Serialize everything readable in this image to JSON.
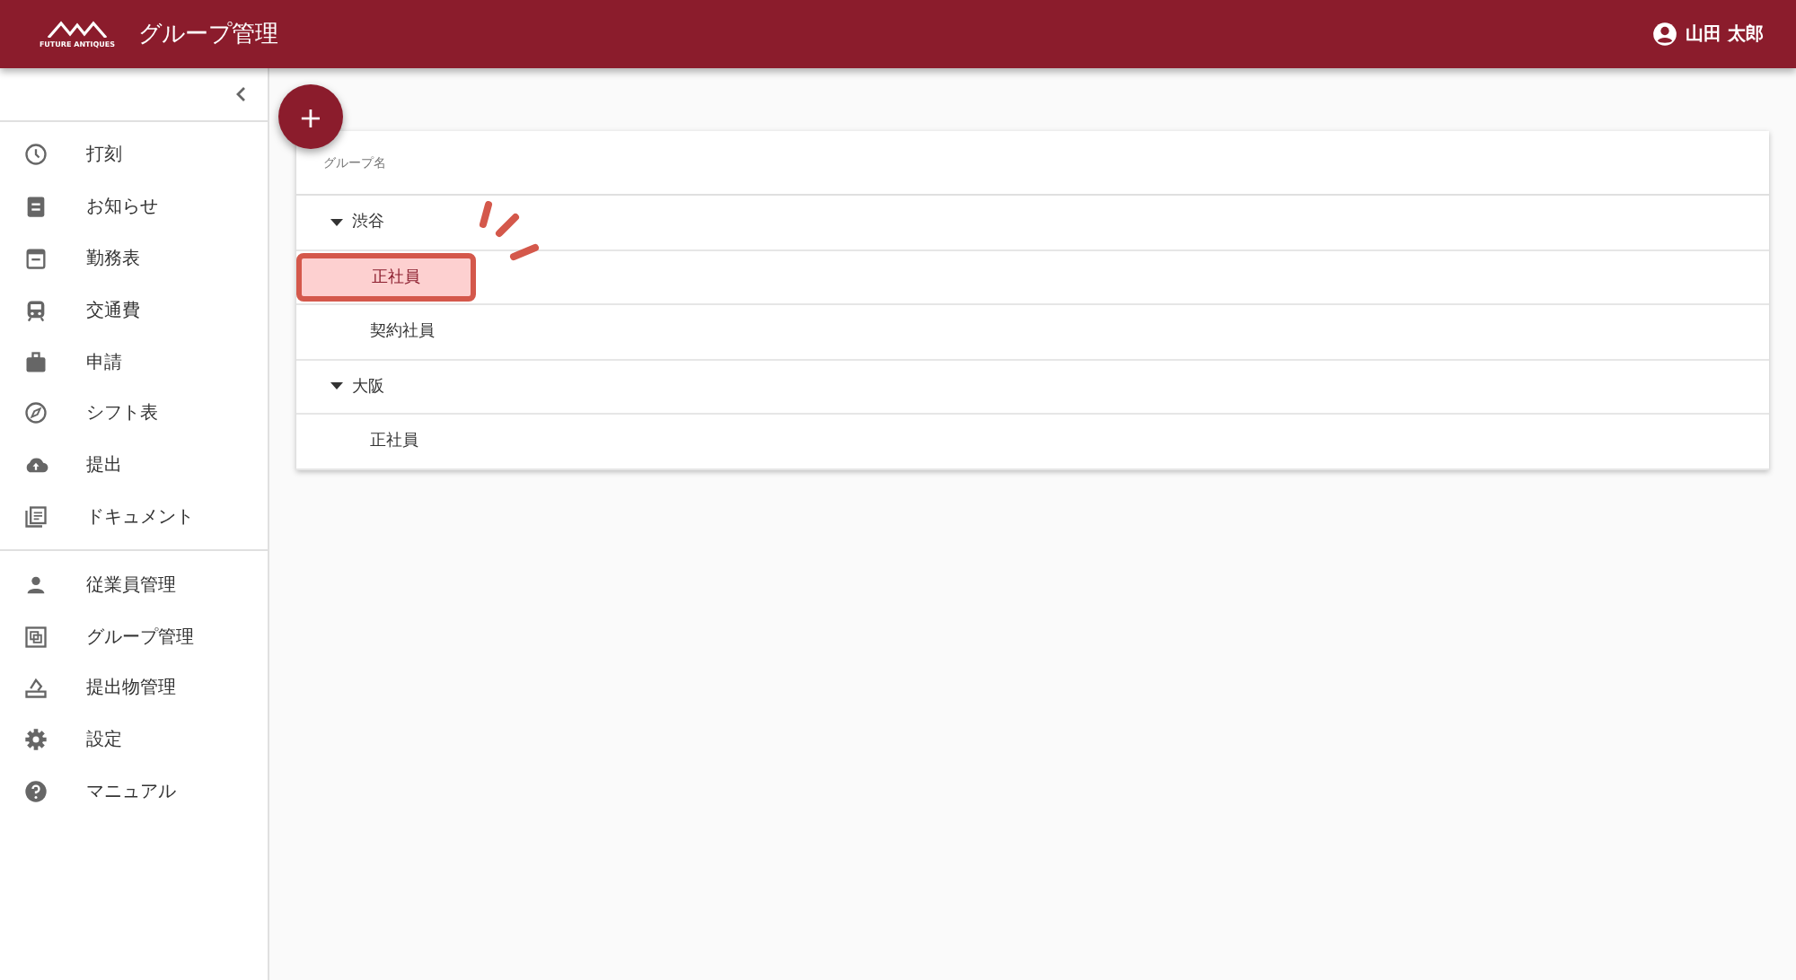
{
  "header": {
    "logo_text": "FUTURE ANTIQUES",
    "title": "グループ管理",
    "user": "山田 太郎"
  },
  "sidebar": {
    "sections": [
      {
        "items": [
          {
            "label": "打刻",
            "selected": false
          },
          {
            "label": "お知らせ",
            "selected": false
          },
          {
            "label": "勤務表",
            "selected": false
          },
          {
            "label": "交通費",
            "selected": false
          },
          {
            "label": "申請",
            "selected": false
          },
          {
            "label": "シフト表",
            "selected": false
          },
          {
            "label": "提出",
            "selected": false
          },
          {
            "label": "ドキュメント",
            "selected": false
          }
        ]
      },
      {
        "items": [
          {
            "label": "従業員管理",
            "selected": false
          },
          {
            "label": "グループ管理",
            "selected": false
          },
          {
            "label": "提出物管理",
            "selected": false
          },
          {
            "label": "設定",
            "selected": false
          },
          {
            "label": "マニュアル",
            "selected": false
          }
        ]
      }
    ]
  },
  "add_button": {
    "label": "+"
  },
  "tree": {
    "column": "グループ名",
    "groups": [
      {
        "label": "渋谷",
        "expanded": true,
        "children": [
          {
            "label": "正社員",
            "highlighted": true
          },
          {
            "label": "契約社員",
            "highlighted": false
          }
        ]
      },
      {
        "label": "大阪",
        "expanded": true,
        "children": [
          {
            "label": "正社員",
            "highlighted": false
          }
        ]
      }
    ]
  }
}
